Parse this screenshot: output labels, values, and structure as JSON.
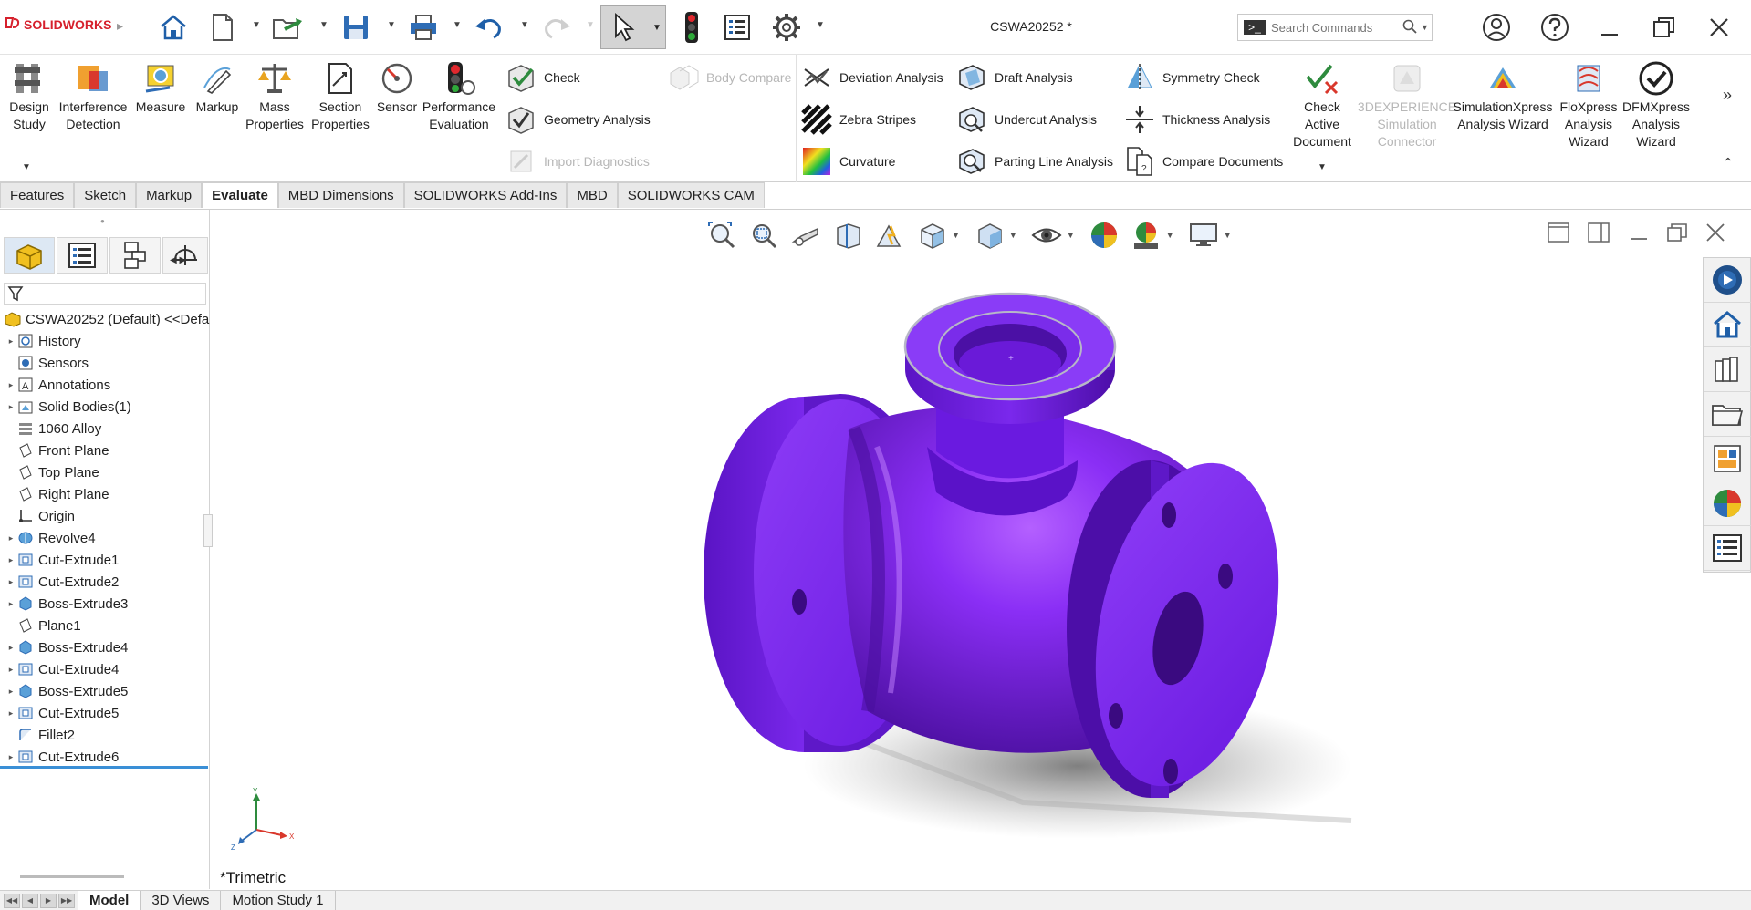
{
  "app": {
    "logo_text": "SOLIDWORKS",
    "document_title": "CSWA20252 *"
  },
  "search": {
    "placeholder": "Search Commands",
    "value": ""
  },
  "command_manager": {
    "big_tools": [
      {
        "label": "Design Study",
        "icon": "design-study-icon",
        "enabled": true
      },
      {
        "label": "Interference Detection",
        "icon": "interference-detection-icon",
        "enabled": true
      },
      {
        "label": "Measure",
        "icon": "measure-icon",
        "enabled": true
      },
      {
        "label": "Markup",
        "icon": "markup-icon",
        "enabled": true
      },
      {
        "label": "Mass Properties",
        "icon": "mass-properties-icon",
        "enabled": true
      },
      {
        "label": "Section Properties",
        "icon": "section-properties-icon",
        "enabled": true
      },
      {
        "label": "Sensor",
        "icon": "sensor-icon",
        "enabled": true
      },
      {
        "label": "Performance Evaluation",
        "icon": "performance-evaluation-icon",
        "enabled": true
      }
    ],
    "small_tools": [
      {
        "label": "Check",
        "icon": "check-icon",
        "enabled": true
      },
      {
        "label": "Body Compare",
        "icon": "body-compare-icon",
        "enabled": false
      },
      {
        "label": "Geometry Analysis",
        "icon": "geometry-analysis-icon",
        "enabled": true
      },
      {
        "label": "Import Diagnostics",
        "icon": "import-diagnostics-icon",
        "enabled": false
      },
      {
        "label": "Deviation Analysis",
        "icon": "deviation-analysis-icon",
        "enabled": true
      },
      {
        "label": "Zebra Stripes",
        "icon": "zebra-stripes-icon",
        "enabled": true
      },
      {
        "label": "Curvature",
        "icon": "curvature-icon",
        "enabled": true
      },
      {
        "label": "Draft Analysis",
        "icon": "draft-analysis-icon",
        "enabled": true
      },
      {
        "label": "Undercut Analysis",
        "icon": "undercut-analysis-icon",
        "enabled": true
      },
      {
        "label": "Parting Line Analysis",
        "icon": "parting-line-analysis-icon",
        "enabled": true
      },
      {
        "label": "Symmetry Check",
        "icon": "symmetry-check-icon",
        "enabled": true
      },
      {
        "label": "Thickness Analysis",
        "icon": "thickness-analysis-icon",
        "enabled": true
      },
      {
        "label": "Compare Documents",
        "icon": "compare-documents-icon",
        "enabled": true
      }
    ],
    "right_tools": [
      {
        "label": "Check Active Document",
        "icon": "check-active-document-icon",
        "enabled": true
      },
      {
        "label": "3DEXPERIENCE Simulation Connector",
        "icon": "3dexperience-simulation-connector-icon",
        "enabled": false
      },
      {
        "label": "SimulationXpress Analysis Wizard",
        "icon": "simulationxpress-icon",
        "enabled": true
      },
      {
        "label": "FloXpress Analysis Wizard",
        "icon": "floxpress-icon",
        "enabled": true
      },
      {
        "label": "DFMXpress Analysis Wizard",
        "icon": "dfmxpress-icon",
        "enabled": true
      }
    ]
  },
  "tabs": [
    {
      "label": "Features",
      "active": false
    },
    {
      "label": "Sketch",
      "active": false
    },
    {
      "label": "Markup",
      "active": false
    },
    {
      "label": "Evaluate",
      "active": true
    },
    {
      "label": "MBD Dimensions",
      "active": false
    },
    {
      "label": "SOLIDWORKS Add-Ins",
      "active": false
    },
    {
      "label": "MBD",
      "active": false
    },
    {
      "label": "SOLIDWORKS CAM",
      "active": false
    }
  ],
  "feature_tree": {
    "root": "CSWA20252 (Default) <<Defa",
    "items": [
      {
        "label": "History",
        "icon": "history-icon",
        "expandable": true
      },
      {
        "label": "Sensors",
        "icon": "sensors-icon",
        "expandable": false
      },
      {
        "label": "Annotations",
        "icon": "annotations-icon",
        "expandable": true
      },
      {
        "label": "Solid Bodies(1)",
        "icon": "solid-bodies-icon",
        "expandable": true
      },
      {
        "label": "1060 Alloy",
        "icon": "material-icon",
        "expandable": false
      },
      {
        "label": "Front Plane",
        "icon": "plane-icon",
        "expandable": false
      },
      {
        "label": "Top Plane",
        "icon": "plane-icon",
        "expandable": false
      },
      {
        "label": "Right Plane",
        "icon": "plane-icon",
        "expandable": false
      },
      {
        "label": "Origin",
        "icon": "origin-icon",
        "expandable": false
      },
      {
        "label": "Revolve4",
        "icon": "revolve-icon",
        "expandable": true
      },
      {
        "label": "Cut-Extrude1",
        "icon": "cut-extrude-icon",
        "expandable": true
      },
      {
        "label": "Cut-Extrude2",
        "icon": "cut-extrude-icon",
        "expandable": true
      },
      {
        "label": "Boss-Extrude3",
        "icon": "boss-extrude-icon",
        "expandable": true
      },
      {
        "label": "Plane1",
        "icon": "plane-icon",
        "expandable": false
      },
      {
        "label": "Boss-Extrude4",
        "icon": "boss-extrude-icon",
        "expandable": true
      },
      {
        "label": "Cut-Extrude4",
        "icon": "cut-extrude-icon",
        "expandable": true
      },
      {
        "label": "Boss-Extrude5",
        "icon": "boss-extrude-icon",
        "expandable": true
      },
      {
        "label": "Cut-Extrude5",
        "icon": "cut-extrude-icon",
        "expandable": true
      },
      {
        "label": "Fillet2",
        "icon": "fillet-icon",
        "expandable": false
      },
      {
        "label": "Cut-Extrude6",
        "icon": "cut-extrude-icon",
        "expandable": true
      }
    ]
  },
  "viewport": {
    "view_orientation": "*Trimetric",
    "model_color": "#7a1ff0",
    "triad": {
      "x": "X",
      "y": "Y",
      "z": "Z"
    }
  },
  "bottom_tabs": [
    {
      "label": "Model",
      "active": true
    },
    {
      "label": "3D Views",
      "active": false
    },
    {
      "label": "Motion Study 1",
      "active": false
    }
  ]
}
